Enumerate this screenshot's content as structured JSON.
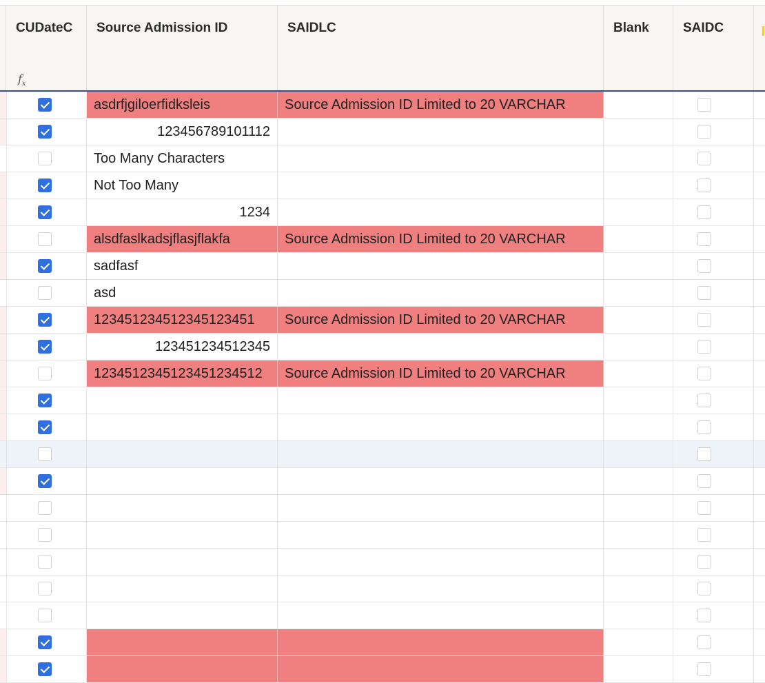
{
  "columns": {
    "cudatec": "CUDateC",
    "said": "Source Admission ID",
    "saidlc": "SAIDLC",
    "blank": "Blank",
    "saidc": "SAIDC"
  },
  "formula_icon": "fx-icon",
  "error_color": "#f08080",
  "checkbox_color": "#2f6fe0",
  "rows": [
    {
      "cu": true,
      "said": "asdrfjgiloerfidksleis",
      "align": "left",
      "err": true,
      "saidlc": "Source Admission ID Limited to 20 VARCHAR"
    },
    {
      "cu": true,
      "said": "123456789101112",
      "align": "right",
      "err": false,
      "saidlc": ""
    },
    {
      "cu": false,
      "said": "Too Many Characters",
      "align": "left",
      "err": false,
      "saidlc": ""
    },
    {
      "cu": true,
      "said": "Not Too Many",
      "align": "left",
      "err": false,
      "saidlc": ""
    },
    {
      "cu": true,
      "said": "1234",
      "align": "right",
      "err": false,
      "saidlc": ""
    },
    {
      "cu": false,
      "said": "alsdfaslkadsjflasjflakfa",
      "align": "left",
      "err": true,
      "saidlc": "Source Admission ID Limited to 20 VARCHAR"
    },
    {
      "cu": true,
      "said": "sadfasf",
      "align": "left",
      "err": false,
      "saidlc": ""
    },
    {
      "cu": false,
      "said": "asd",
      "align": "left",
      "err": false,
      "saidlc": ""
    },
    {
      "cu": true,
      "said": "123451234512345123451",
      "align": "left",
      "err": true,
      "saidlc": "Source Admission ID Limited to 20 VARCHAR"
    },
    {
      "cu": true,
      "said": "123451234512345",
      "align": "right",
      "err": false,
      "saidlc": ""
    },
    {
      "cu": false,
      "said": "1234512345123451234512",
      "align": "left",
      "err": true,
      "saidlc": "Source Admission ID Limited to 20 VARCHAR"
    },
    {
      "cu": true,
      "said": "",
      "align": "left",
      "err": false,
      "saidlc": ""
    },
    {
      "cu": true,
      "said": "",
      "align": "left",
      "err": false,
      "saidlc": ""
    },
    {
      "cu": false,
      "said": "",
      "align": "left",
      "err": false,
      "saidlc": "",
      "hover": true
    },
    {
      "cu": true,
      "said": "",
      "align": "left",
      "err": false,
      "saidlc": ""
    },
    {
      "cu": false,
      "said": "",
      "align": "left",
      "err": false,
      "saidlc": ""
    },
    {
      "cu": false,
      "said": "",
      "align": "left",
      "err": false,
      "saidlc": ""
    },
    {
      "cu": false,
      "said": "",
      "align": "left",
      "err": false,
      "saidlc": ""
    },
    {
      "cu": false,
      "said": "",
      "align": "left",
      "err": false,
      "saidlc": ""
    },
    {
      "cu": false,
      "said": "",
      "align": "left",
      "err": false,
      "saidlc": ""
    },
    {
      "cu": true,
      "said": "",
      "align": "left",
      "err": true,
      "saidlc": ""
    },
    {
      "cu": true,
      "said": "",
      "align": "left",
      "err": true,
      "saidlc": ""
    }
  ]
}
